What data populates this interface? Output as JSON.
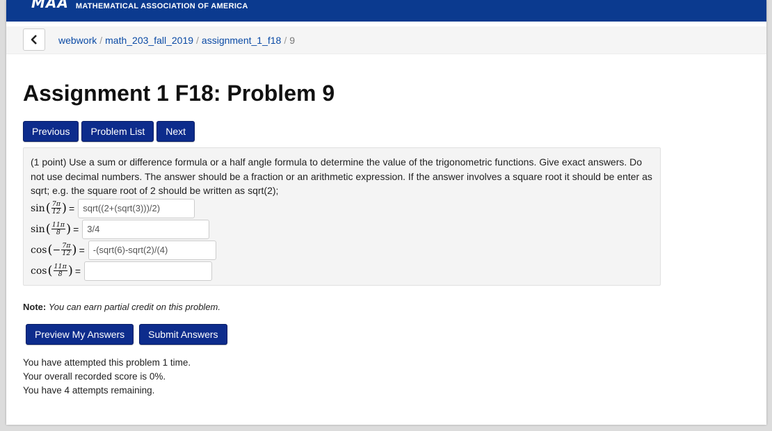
{
  "header": {
    "logo_mark": "MAA",
    "org_name": "MATHEMATICAL ASSOCIATION OF AMERICA",
    "brand_color": "#0b3a8f"
  },
  "breadcrumb": {
    "back_icon": "chevron-left-icon",
    "items": [
      "webwork",
      "math_203_fall_2019",
      "assignment_1_f18"
    ],
    "current": "9"
  },
  "page": {
    "title": "Assignment 1 F18: Problem 9"
  },
  "nav": {
    "previous": "Previous",
    "problem_list": "Problem List",
    "next": "Next"
  },
  "problem": {
    "text": "(1 point) Use a sum or difference formula or a half angle formula to determine the value of the trigonometric functions. Give exact answers. Do not use decimal numbers. The answer should be a fraction or an arithmetic expression. If the answer involves a square root it should be enter as sqrt; e.g. the square root of 2 should be written as sqrt(2);",
    "parts": [
      {
        "fn": "sin",
        "sign": "",
        "num": "7π",
        "den": "12",
        "eq": "=",
        "value": "sqrt((2+(sqrt(3)))/2)"
      },
      {
        "fn": "sin",
        "sign": "",
        "num": "11π",
        "den": "8",
        "eq": "=",
        "value": "3/4"
      },
      {
        "fn": "cos",
        "sign": "−",
        "num": "7π",
        "den": "12",
        "eq": "=",
        "value": "-(sqrt(6)-sqrt(2)/(4)"
      },
      {
        "fn": "cos",
        "sign": "",
        "num": "11π",
        "den": "8",
        "eq": "=",
        "value": ""
      }
    ]
  },
  "note": {
    "label": "Note:",
    "text": "You can earn partial credit on this problem."
  },
  "actions": {
    "preview": "Preview My Answers",
    "submit": "Submit Answers"
  },
  "status": {
    "attempted_prefix": "You have attempted this problem ",
    "attempted_count": "1",
    "attempted_suffix": " time.",
    "score": "Your overall recorded score is 0%.",
    "remaining": "You have 4 attempts remaining."
  }
}
